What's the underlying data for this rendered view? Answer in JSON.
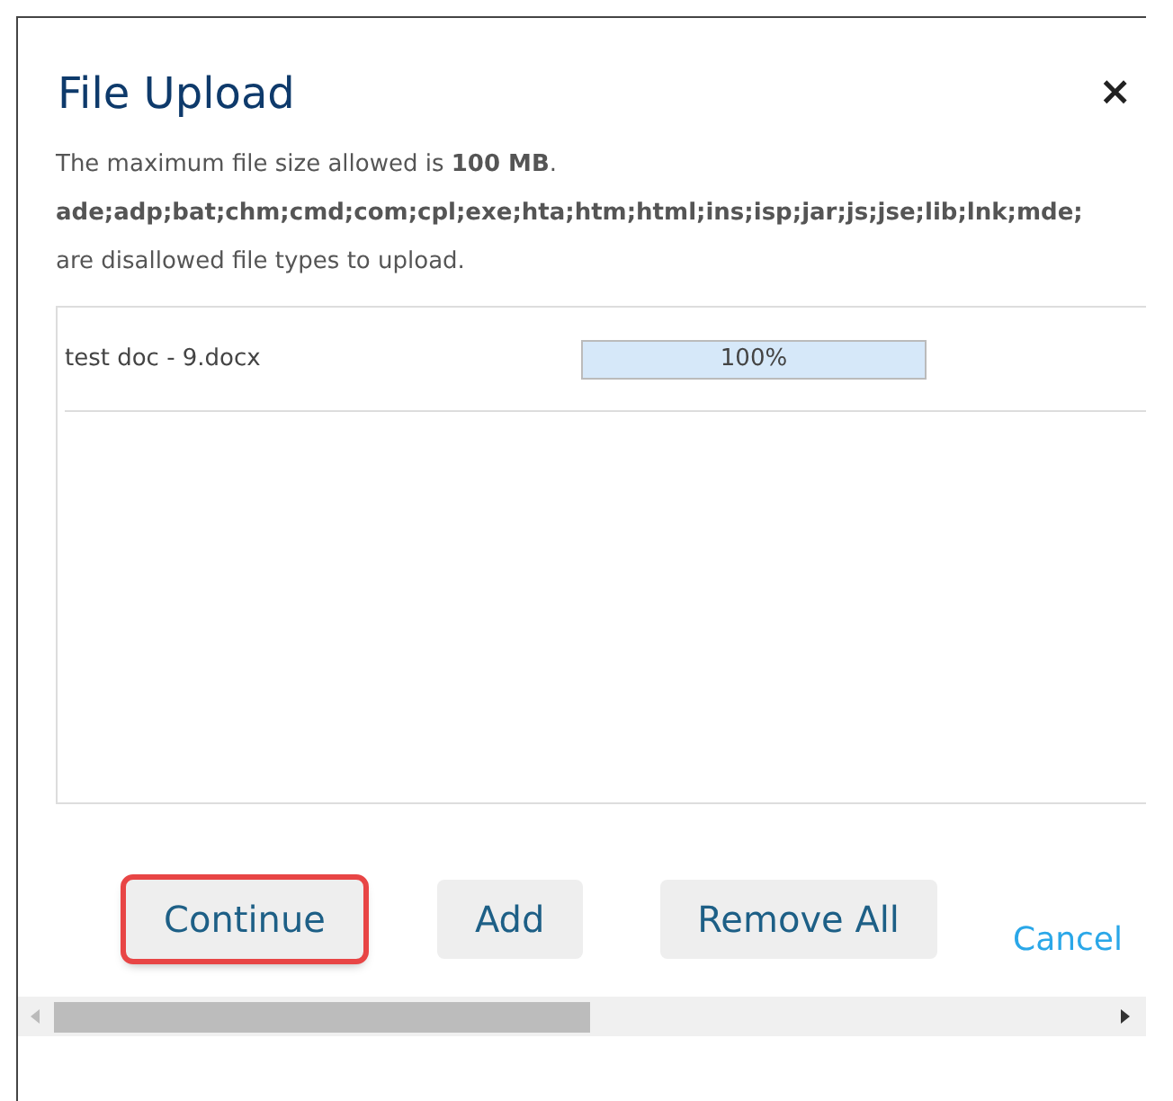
{
  "dialog": {
    "title": "File Upload",
    "close": "×",
    "size_notice": "The maximum file size allowed is **100 MB**.",
    "disallowed_types": "ade;adp;bat;chm;cmd;com;cpl;exe;hta;htm;html;ins;isp;jar;js;jse;lib;lnk;mde;",
    "disallowed_note": "are disallowed file types to upload.",
    "files": [
      {
        "name": "test doc - 9.docx",
        "level": 1,
        "reading": "100%"
      }
    ],
    "buttons": [
      {
        "label": "Continue",
        "kind": "button",
        "highlighted": true
      },
      {
        "label": "Add",
        "kind": "button",
        "highlighted": false
      },
      {
        "label": "Remove All",
        "kind": "button",
        "highlighted": false
      },
      {
        "label": "Cancel",
        "kind": "link",
        "highlighted": false
      }
    ]
  }
}
